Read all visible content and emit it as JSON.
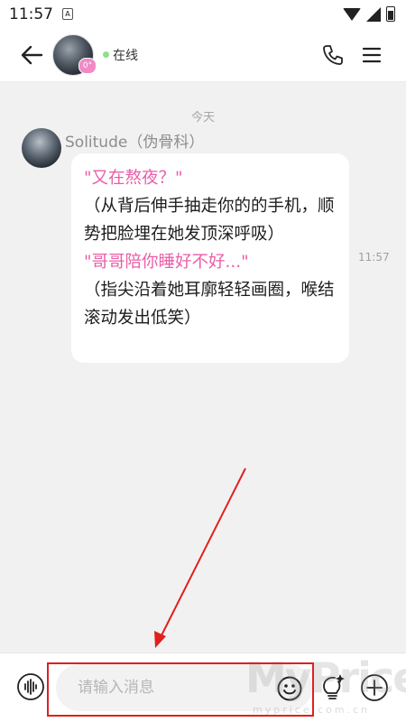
{
  "status_bar": {
    "time": "11:57",
    "notification_icon": "A"
  },
  "header": {
    "badge_text": "0°",
    "online_label": "在线"
  },
  "chat": {
    "date_label": "今天",
    "message": {
      "sender": "Solitude（伪骨科）",
      "lines": [
        {
          "text": "\"又在熬夜？\"",
          "color": "#ea5ea8"
        },
        {
          "text": "（从背后伸手抽走你的的手机，顺势把脸埋在她发顶深呼吸）",
          "color": "#1d1d1d"
        },
        {
          "text": "\"哥哥陪你睡好不好...\"",
          "color": "#ea5ea8"
        },
        {
          "text": "（指尖沿着她耳廓轻轻画圈，喉结滚动发出低笑）",
          "color": "#1d1d1d"
        }
      ],
      "time": "11:57"
    }
  },
  "input_bar": {
    "placeholder": "请输入消息",
    "value": ""
  },
  "watermark": {
    "text": "MyPrice",
    "sub": "myprice.com.cn"
  },
  "icons": {
    "back": "arrow-left-icon",
    "phone": "phone-icon",
    "menu": "menu-icon",
    "voice": "voice-wave-icon",
    "emoji": "emoji-icon",
    "bulb": "lightbulb-sparkle-icon",
    "plus": "plus-circle-icon"
  },
  "colors": {
    "accent_pink": "#ea5ea8",
    "online_green": "#8be08b",
    "annotation_red": "#e11f1f"
  }
}
